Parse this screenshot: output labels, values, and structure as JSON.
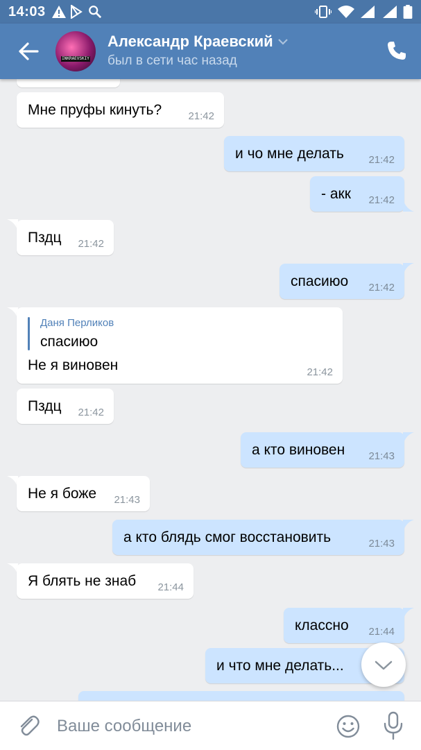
{
  "status_bar": {
    "time": "14:03"
  },
  "header": {
    "contact_name": "Александр Краевский",
    "status": "был в сети час назад",
    "avatar_text": "INKRAEVSKIY"
  },
  "messages": [
    {
      "dir": "in",
      "text": "Мне пруфы кинуть?",
      "time": "21:42"
    },
    {
      "dir": "out",
      "text": "и чо мне делать",
      "time": "21:42"
    },
    {
      "dir": "out",
      "text": "- акк",
      "time": "21:42"
    },
    {
      "dir": "in",
      "text": "Пздц",
      "time": "21:42"
    },
    {
      "dir": "out",
      "text": "спасиюо",
      "time": "21:42"
    },
    {
      "dir": "in",
      "reply_author": "Даня Перликов",
      "reply_text": "спасиюо",
      "text": "Не я виновен",
      "time": "21:42"
    },
    {
      "dir": "in",
      "text": "Пздц",
      "time": "21:42"
    },
    {
      "dir": "out",
      "text": "а кто виновен",
      "time": "21:43"
    },
    {
      "dir": "in",
      "text": "Не я боже",
      "time": "21:43"
    },
    {
      "dir": "out",
      "text": "а кто блядь смог восстановить",
      "time": "21:43"
    },
    {
      "dir": "in",
      "text": "Я блять не знаб",
      "time": "21:44"
    },
    {
      "dir": "out",
      "text": "классно",
      "time": "21:44"
    },
    {
      "dir": "out",
      "text": "и что мне делать...",
      "time": ""
    }
  ],
  "input": {
    "placeholder": "Ваше сообщение"
  },
  "colors": {
    "header": "#5181b8",
    "status_bar": "#4a76a8",
    "incoming": "#ffffff",
    "outgoing": "#cce4ff",
    "background": "#edeef0"
  },
  "icons": [
    "back-arrow-icon",
    "chevron-down-icon",
    "phone-icon",
    "paperclip-icon",
    "smile-icon",
    "microphone-icon",
    "scroll-down-icon"
  ]
}
